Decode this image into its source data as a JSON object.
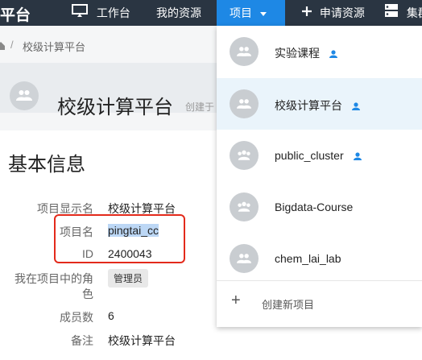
{
  "topbar": {
    "brand": "平台",
    "workbench": "工作台",
    "my_resources": "我的资源",
    "projects": "项目",
    "apply_resources": "申请资源",
    "cluster": "集群"
  },
  "breadcrumb": {
    "current": "校级计算平台"
  },
  "header": {
    "title": "校级计算平台",
    "created": "创建于"
  },
  "basic_info": {
    "title": "基本信息",
    "fields": [
      {
        "label": "项目显示名",
        "value": "校级计算平台"
      },
      {
        "label": "项目名",
        "value": "pingtai_cc"
      },
      {
        "label": "ID",
        "value": "2400043"
      },
      {
        "label": "我在项目中的角色",
        "label_line1": "我在项目中的角",
        "label_line2": "色",
        "value": "管理员"
      },
      {
        "label": "成员数",
        "value": "6"
      },
      {
        "label": "备注",
        "value": "校级计算平台"
      }
    ]
  },
  "dropdown": {
    "items": [
      {
        "label": "实验课程",
        "owner_icon": true,
        "selected": false
      },
      {
        "label": "校级计算平台",
        "owner_icon": true,
        "selected": true
      },
      {
        "label": "public_cluster",
        "owner_icon": true,
        "selected": false
      },
      {
        "label": "Bigdata-Course",
        "owner_icon": false,
        "selected": false
      },
      {
        "label": "chem_lai_lab",
        "owner_icon": false,
        "selected": false
      }
    ],
    "create_label": "创建新项目"
  },
  "colors": {
    "topbar": "#2a3542",
    "accent": "#1e88e5",
    "annotation": "#e32a1b"
  },
  "icons": [
    "monitor-icon",
    "plus-icon",
    "server-icon",
    "home-icon",
    "group-icon",
    "person-icon"
  ]
}
